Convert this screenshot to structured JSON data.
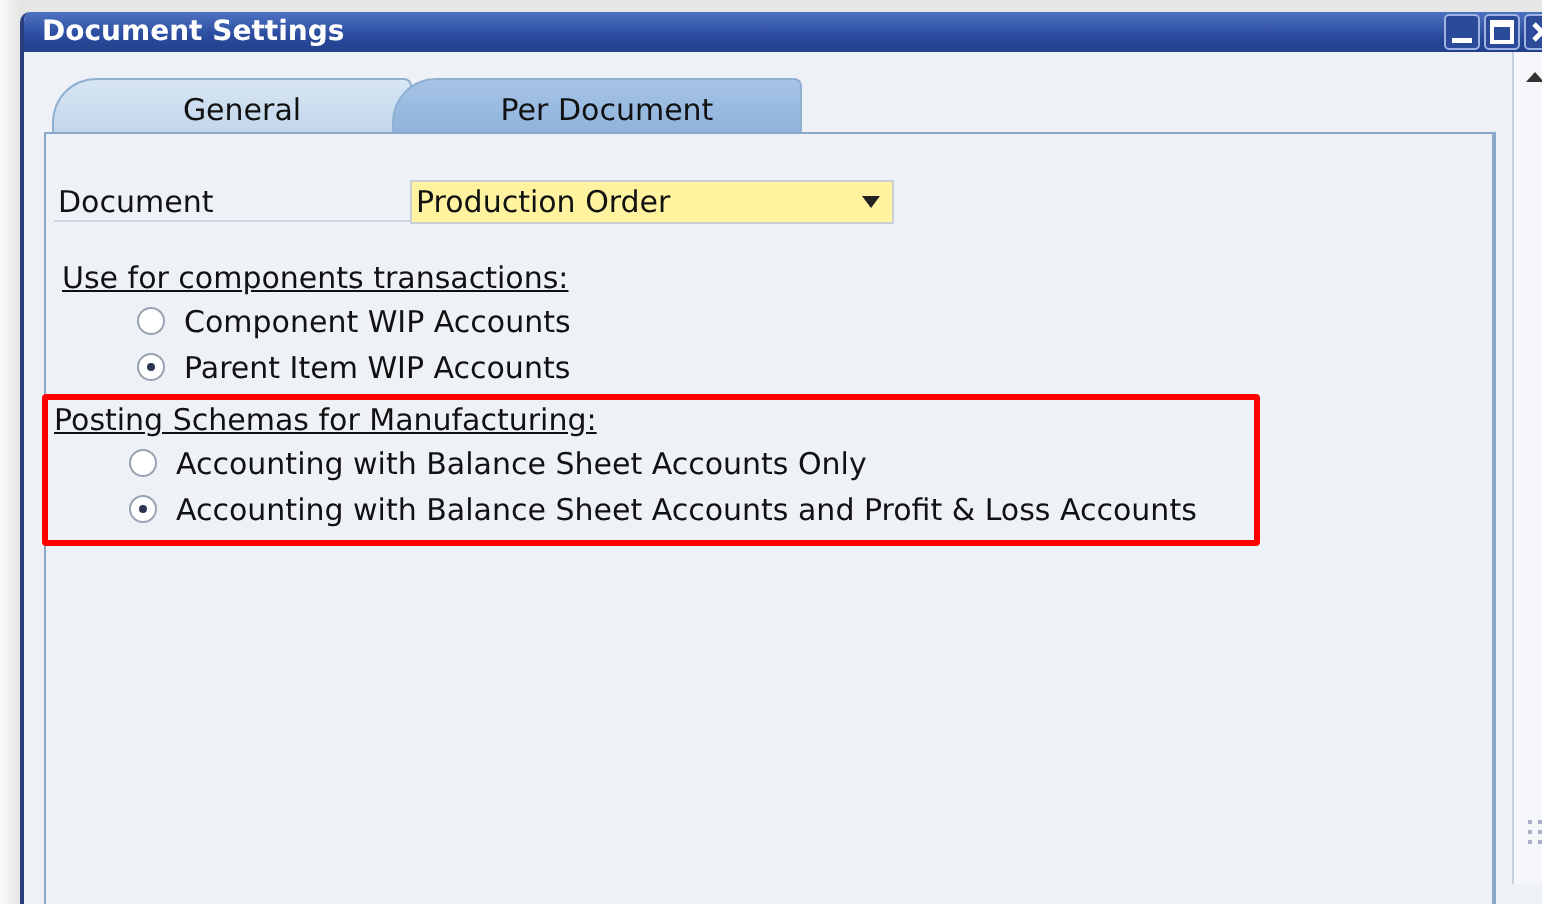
{
  "window": {
    "title": "Document Settings"
  },
  "tabs": [
    {
      "label": "General",
      "selected": false
    },
    {
      "label": "Per Document",
      "selected": true
    }
  ],
  "document_field": {
    "label": "Document",
    "value": "Production Order"
  },
  "groups": [
    {
      "heading": "Use for components transactions:",
      "highlighted": false,
      "options": [
        {
          "label": "Component WIP Accounts",
          "selected": false
        },
        {
          "label": "Parent Item WIP Accounts",
          "selected": true
        }
      ]
    },
    {
      "heading": "Posting Schemas for Manufacturing:",
      "highlighted": true,
      "options": [
        {
          "label": "Accounting with Balance Sheet Accounts Only",
          "selected": false
        },
        {
          "label": "Accounting with Balance Sheet Accounts and Profit & Loss Accounts",
          "selected": true
        }
      ]
    }
  ]
}
